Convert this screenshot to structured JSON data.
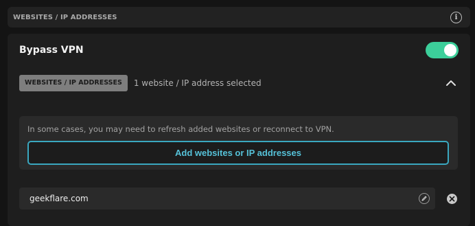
{
  "header": {
    "title": "WEBSITES / IP ADDRESSES",
    "info_icon": "info-icon"
  },
  "bypass": {
    "label": "Bypass VPN",
    "enabled": true,
    "toggle_color": "#3ccf9a"
  },
  "type_row": {
    "chip_label": "WEBSITES / IP ADDRESSES",
    "selected_text": "1 website / IP address selected",
    "collapse_icon": "chevron-up-icon"
  },
  "notice": {
    "text": "In some cases, you may need to refresh added websites or reconnect to VPN.",
    "add_button_label": "Add websites or IP addresses",
    "accent_color": "#3aa8c0"
  },
  "entries": [
    {
      "value": "geekflare.com",
      "edit_icon": "edit-icon",
      "remove_icon": "remove-icon"
    }
  ]
}
